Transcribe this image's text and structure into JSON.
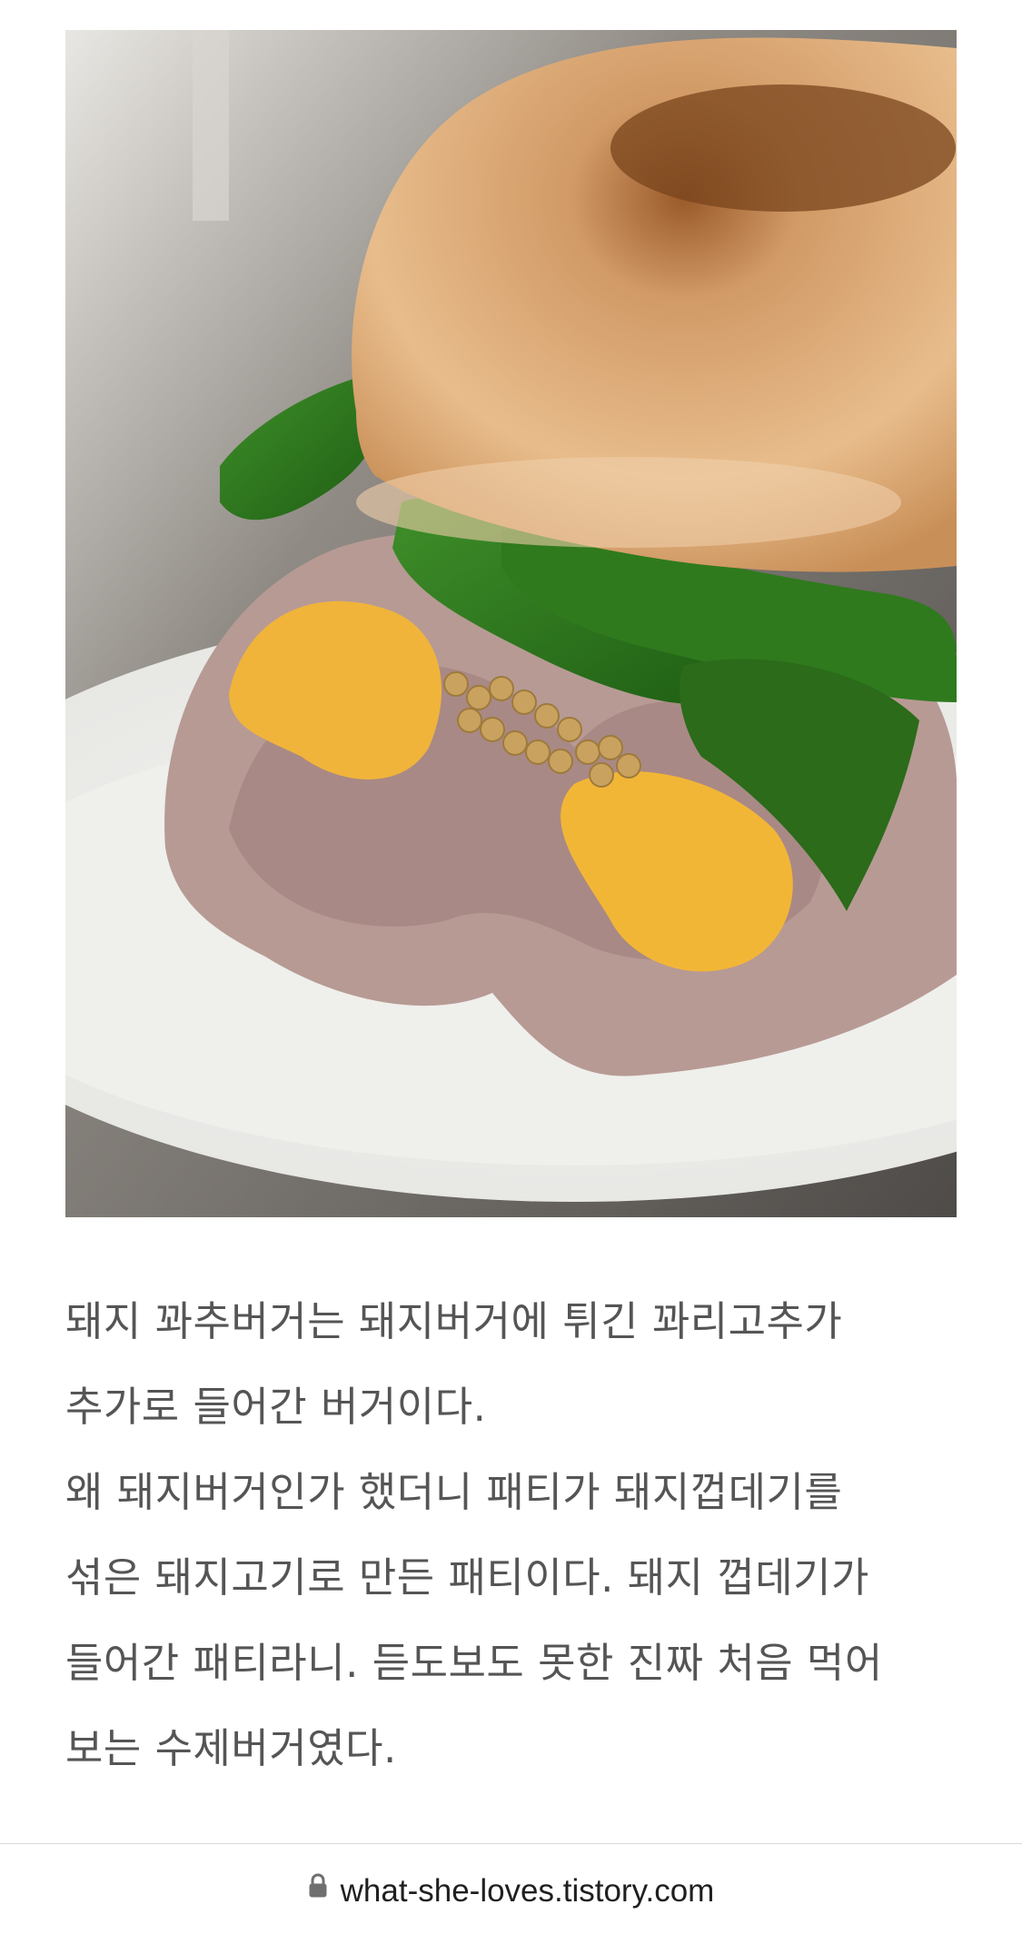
{
  "photo": {
    "subject": "burger-photo"
  },
  "article": {
    "lines": [
      "돼지 꽈추버거는 돼지버거에 튀긴 꽈리고추가",
      "추가로 들어간 버거이다.",
      "왜 돼지버거인가 했더니 패티가 돼지껍데기를",
      "섞은 돼지고기로 만든 패티이다. 돼지 껍데기가",
      "들어간 패티라니. 듣도보도 못한 진짜 처음 먹어",
      "보는 수제버거였다."
    ]
  },
  "address_bar": {
    "url": "what-she-loves.tistory.com",
    "icon": "lock-icon"
  }
}
